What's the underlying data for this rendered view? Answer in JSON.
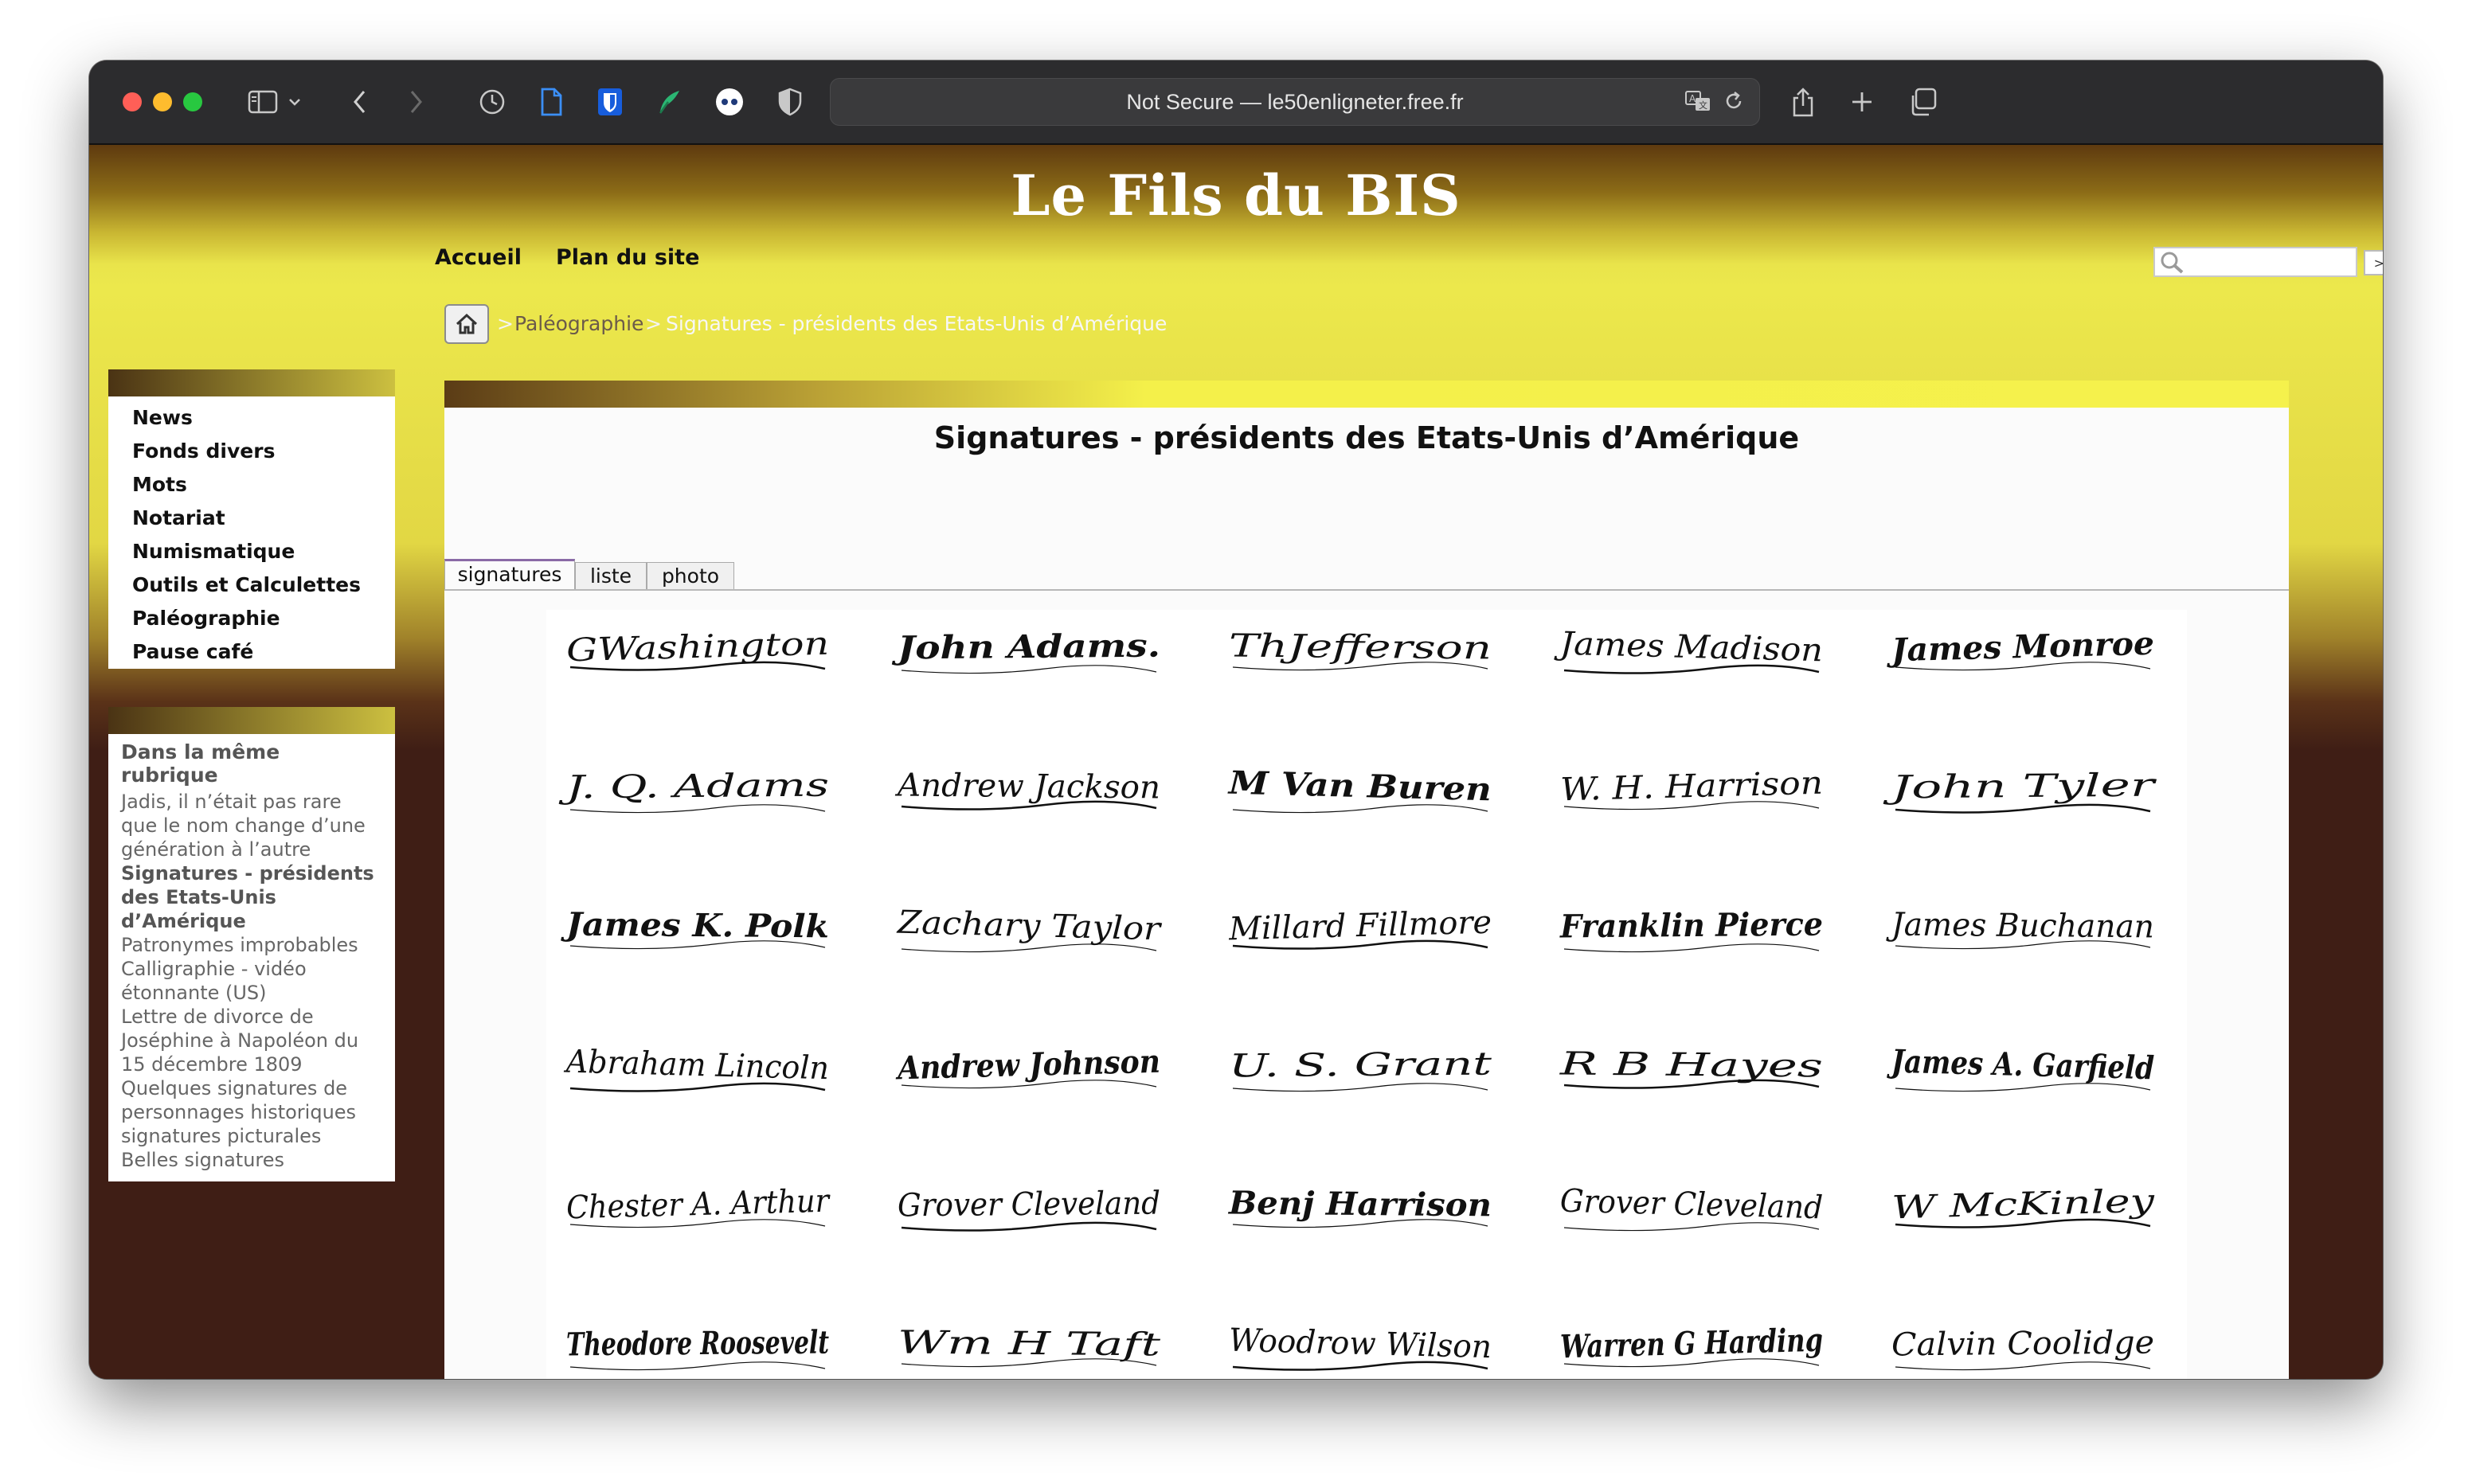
{
  "browser": {
    "url_text": "Not Secure — le50enligneter.free.fr"
  },
  "site": {
    "logo": "Le Fils du BIS",
    "nav": [
      "Accueil",
      "Plan du site"
    ],
    "search_button": ">>"
  },
  "sidebar": {
    "menu": [
      "News",
      "Fonds divers",
      "Mots",
      "Notariat",
      "Numismatique",
      "Outils et Calculettes",
      "Paléographie",
      "Pause café"
    ],
    "rubrique_title": "Dans la même rubrique",
    "rubrique_items": [
      "Jadis, il n’était pas rare que le nom change d’une génération à l’autre",
      "Signatures - présidents des Etats-Unis d’Amérique",
      "Patronymes improbables",
      "Calligraphie - vidéo étonnante (US)",
      "Lettre de divorce de Joséphine à Napoléon du 15 décembre 1809",
      "Quelques signatures de personnages historiques",
      "signatures picturales",
      "Belles signatures"
    ],
    "current_index": 1
  },
  "breadcrumb": {
    "sep": ">",
    "section": "Paléographie",
    "current": "Signatures - présidents des Etats-Unis d’Amérique"
  },
  "main": {
    "title": "Signatures - présidents des Etats-Unis d’Amérique",
    "tabs": [
      "signatures",
      "liste",
      "photo"
    ],
    "active_tab": 0
  },
  "signatures": [
    "GWashington",
    "John Adams.",
    "ThJefferson",
    "James Madison",
    "James Monroe",
    "J. Q. Adams",
    "Andrew Jackson",
    "M Van Buren",
    "W. H. Harrison",
    "John Tyler",
    "James K. Polk",
    "Zachary Taylor",
    "Millard Fillmore",
    "Franklin Pierce",
    "James Buchanan",
    "Abraham Lincoln",
    "Andrew Johnson",
    "U. S. Grant",
    "R B Hayes",
    "James A. Garfield",
    "Chester A. Arthur",
    "Grover Cleveland",
    "Benj Harrison",
    "Grover Cleveland",
    "W McKinley",
    "Theodore Roosevelt",
    "Wm H Taft",
    "Woodrow Wilson",
    "Warren G Harding",
    "Calvin Coolidge"
  ]
}
